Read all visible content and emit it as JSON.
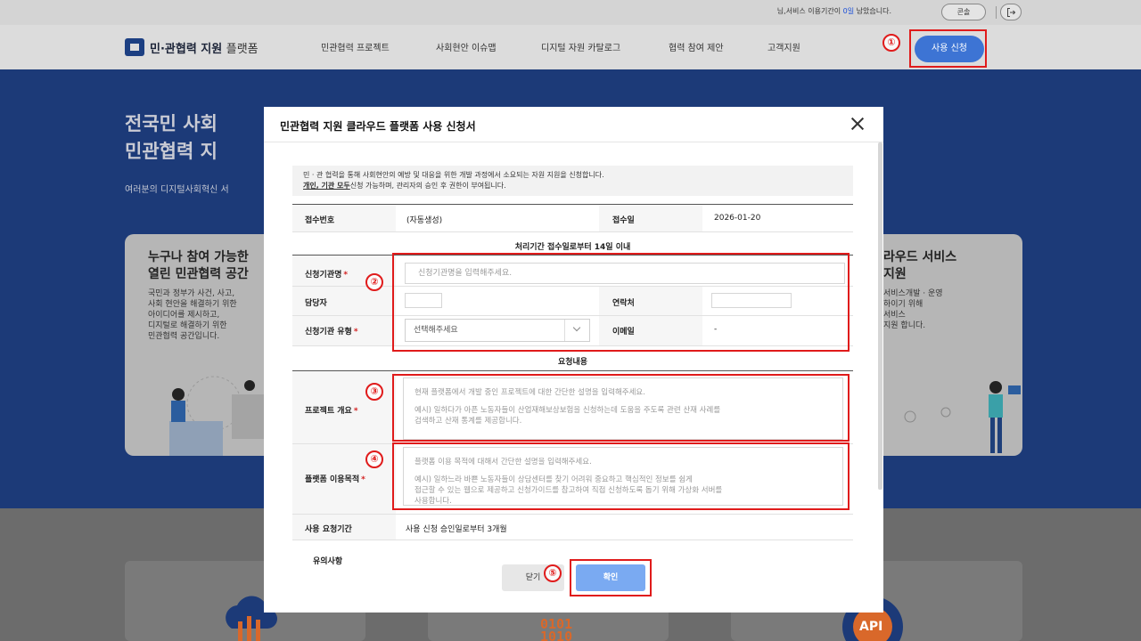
{
  "topbar": {
    "notice_prefix": "님,서비스 이용기간이 ",
    "notice_days": "0일",
    "notice_suffix": " 남았습니다.",
    "console_label": "콘솔",
    "logout_icon": "logout-icon"
  },
  "nav": {
    "logo_main": "민·관협력 지원",
    "logo_sub": "플랫폼",
    "items": [
      "민관협력 프로젝트",
      "사회현안 이슈맵",
      "디지털 자원 카탈로그",
      "협력 참여 제안",
      "고객지원"
    ],
    "apply_label": "사용 신청"
  },
  "hero": {
    "title_line1": "전국민 사회",
    "title_line2": "민관협력 지",
    "subtitle": "여러분의 디지털사회혁신 서",
    "card_left": {
      "title_line1": "누구나 참여 가능한",
      "title_line2": "열린 민관협력 공간",
      "text": [
        "국민과 정부가 사건, 사고,",
        "사회 현안을 해결하기 위한",
        "아이디어를 제시하고,",
        "디지털로 해결하기 위한",
        "민관협력 공간입니다."
      ]
    },
    "card_right": {
      "title_line1": "라우드 서비스",
      "title_line2": "지원",
      "text": [
        "서비스개발 · 운영",
        "하이기 위해",
        "서비스",
        "지원 합니다."
      ]
    },
    "tile_labels": [
      "0101",
      "1010",
      "API"
    ]
  },
  "modal": {
    "title": "민관협력 지원 클라우드 플랫폼 사용 신청서",
    "intro_line1": "민 · 관 협력을 통해 사회현안의 예방 및 대응을 위한 개발 과정에서 소요되는 자원 지원을 신청합니다.",
    "intro_line2_bold": "개인, 기관 모두",
    "intro_line2_rest": "신청 가능하며, 관리자의 승인 후 권한이 부여됩니다.",
    "receipt_no_label": "접수번호",
    "receipt_no_value": "(자동생성)",
    "receipt_date_label": "접수일",
    "receipt_date_value": "2026-01-20",
    "processing_note": "처리기간 접수일로부터 14일 이내",
    "org_name_label": "신청기관명",
    "org_name_placeholder": "신청기관명을 입력해주세요.",
    "manager_label": "담당자",
    "manager_value": "",
    "contact_label": "연락처",
    "contact_value": "",
    "org_type_label": "신청기관 유형",
    "org_type_selected": "선택해주세요",
    "email_label": "이메일",
    "email_value": "-",
    "request_section": "요청내용",
    "project_label": "프로젝트 개요",
    "project_placeholder": [
      "현재 플랫폼에서 개발 중인 프로젝트에 대한 간단한 설명을 입력해주세요.",
      "",
      "예시) 일하다가 아픈 노동자들이 산업재해보상보험을 신청하는데 도움을 주도록 관련 산재 사례를",
      "검색하고 산재 통계를 제공합니다."
    ],
    "purpose_label": "플랫폼 이용목적",
    "purpose_placeholder": [
      "플랫폼 이용 목적에 대해서 간단한 설명을 입력해주세요.",
      "",
      "예시) 일하느라 바쁜 노동자들이 상담센터를 찾기 어려워 중요하고 핵심적인 정보를 쉽게",
      "접근할 수 있는 웹으로 제공하고 신청가이드를 참고하여 직접 신청하도록 돕기 위해 가상화 서버를",
      "사용합니다."
    ],
    "period_label": "사용 요청기간",
    "period_value": "사용 신청 승인일로부터 3개월",
    "notice_label": "유의사항",
    "close_btn": "닫기",
    "confirm_btn": "확인"
  },
  "annotations": [
    "①",
    "②",
    "③",
    "④",
    "⑤"
  ],
  "colors": {
    "annotation_red": "#e01b1b",
    "primary_blue": "#3d74d4",
    "confirm_blue": "#7aaaf2"
  }
}
